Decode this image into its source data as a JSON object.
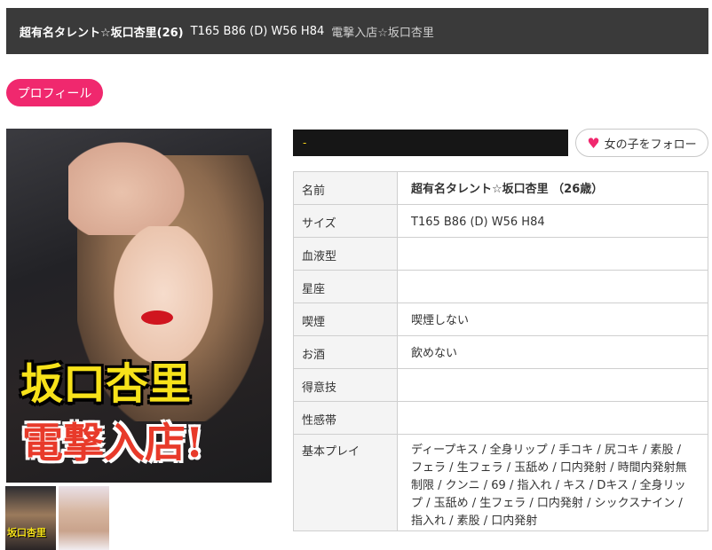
{
  "header": {
    "name": "超有名タレント☆坂口杏里(26)",
    "size": "T165 B86 (D) W56 H84",
    "subtitle": "電撃入店☆坂口杏里"
  },
  "tabs": {
    "profile": "プロフィール"
  },
  "photo": {
    "caption_line1": "坂口杏里",
    "caption_line2": "電撃入店!",
    "thumb1_caption": "坂口杏里"
  },
  "name_bar": {
    "text": "-"
  },
  "follow_button": {
    "label": "女の子をフォロー",
    "icon": "heart-icon",
    "accent": "#f0286e"
  },
  "profile": {
    "rows": [
      {
        "key": "名前",
        "value": "超有名タレント☆坂口杏里 （26歳）"
      },
      {
        "key": "サイズ",
        "value": "T165 B86 (D) W56 H84"
      },
      {
        "key": "血液型",
        "value": ""
      },
      {
        "key": "星座",
        "value": ""
      },
      {
        "key": "喫煙",
        "value": "喫煙しない"
      },
      {
        "key": "お酒",
        "value": "飲めない"
      },
      {
        "key": "得意技",
        "value": ""
      },
      {
        "key": "性感帯",
        "value": ""
      },
      {
        "key": "基本プレイ",
        "value": "ディープキス / 全身リップ / 手コキ / 尻コキ / 素股 / フェラ / 生フェラ / 玉舐め / 口内発射 / 時間内発射無制限 / クンニ / 69 / 指入れ / キス / Dキス / 全身リップ / 玉舐め / 生フェラ / 口内発射 / シックスナイン / 指入れ / 素股 / 口内発射"
      }
    ]
  },
  "colors": {
    "header_bg": "#3a3a3a",
    "accent_pink": "#f0286e",
    "name_bar_bg": "#161616",
    "name_bar_text": "#f7d417"
  }
}
